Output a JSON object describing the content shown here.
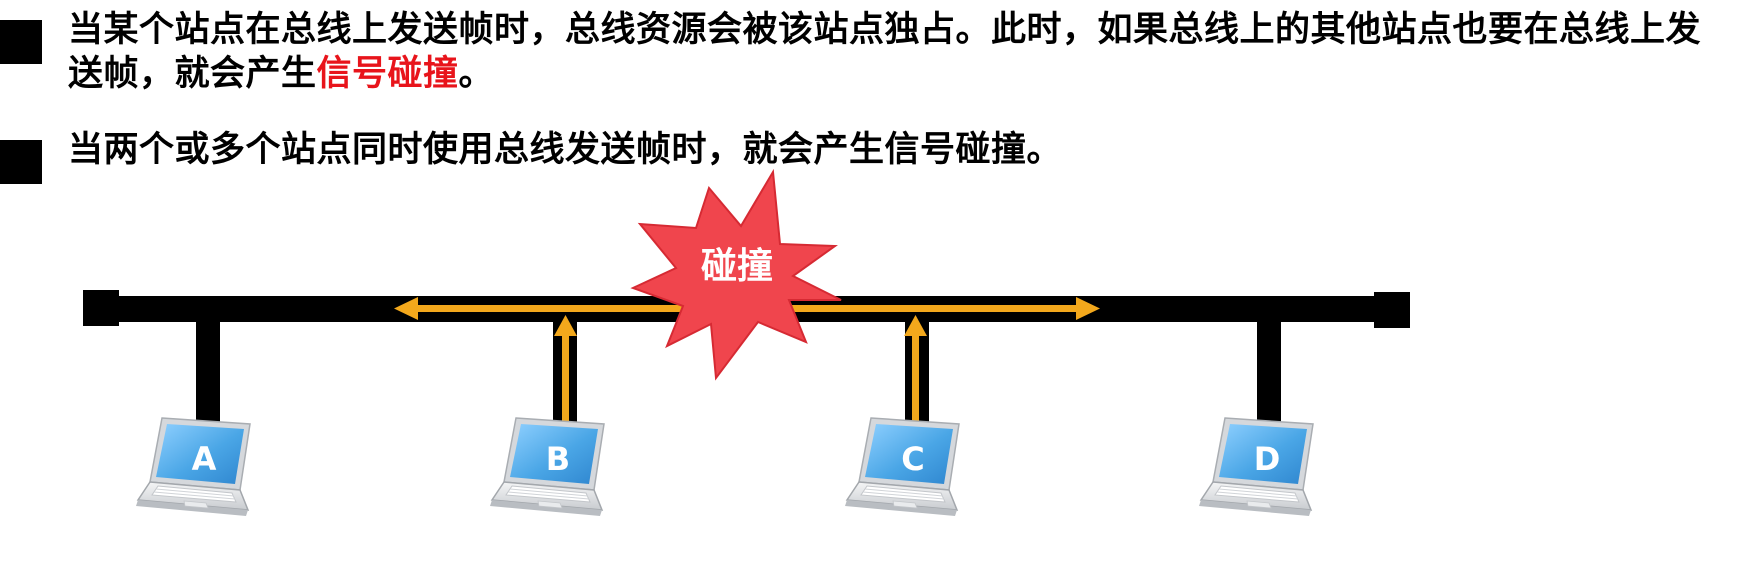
{
  "bullets": [
    {
      "text_before": "当某个站点在总线上发送帧时，总线资源会被该站点独占。此时，如果总线上的其他站点也要在总线上发送帧，就会产生",
      "highlight": "信号碰撞",
      "text_after": "。"
    },
    {
      "text_before": "当两个或多个站点同时使用总线发送帧时，就会产生信号碰撞。",
      "highlight": "",
      "text_after": ""
    }
  ],
  "diagram": {
    "collision_label": "碰撞",
    "stations": [
      "A",
      "B",
      "C",
      "D"
    ],
    "colors": {
      "bus": "#000000",
      "signal": "#f3a81c",
      "highlight": "#e8141b",
      "burst": "#f0454d",
      "screen": "#5aaee8",
      "laptop_body": "#e4e6e8"
    }
  }
}
